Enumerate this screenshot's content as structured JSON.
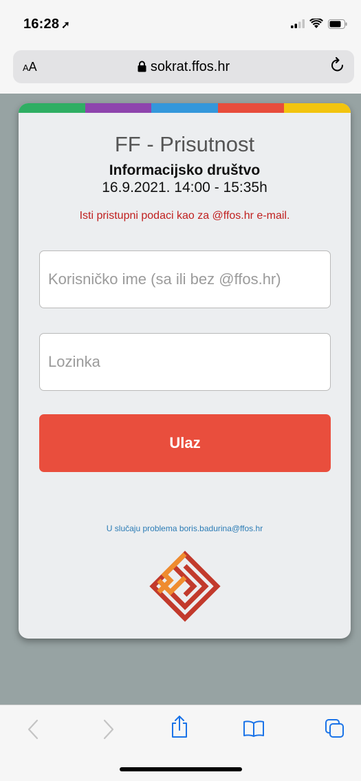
{
  "status_bar": {
    "time": "16:28",
    "location_glyph": "location-arrow-icon"
  },
  "browser": {
    "aa_label": "AA",
    "url": "sokrat.ffos.hr"
  },
  "card": {
    "colors": [
      "#2fae63",
      "#8e44ad",
      "#3497db",
      "#e74c3c",
      "#f2c40f"
    ],
    "title": "FF - Prisutnost",
    "course": "Informacijsko društvo",
    "datetime": "16.9.2021. 14:00 - 15:35h",
    "info": "Isti pristupni podaci kao za @ffos.hr e-mail.",
    "username_placeholder": "Korisničko ime (sa ili bez @ffos.hr)",
    "password_placeholder": "Lozinka",
    "login_label": "Ulaz",
    "help_text": "U slučaju problema boris.badurina@ffos.hr"
  },
  "toolbar": {
    "items": [
      "back-icon",
      "forward-icon",
      "share-icon",
      "bookmarks-icon",
      "tabs-icon"
    ]
  }
}
